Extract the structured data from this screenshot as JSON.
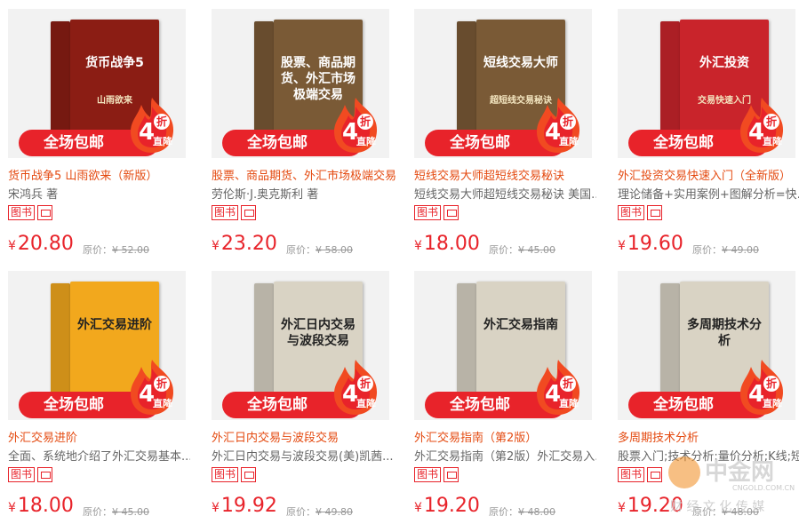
{
  "products": [
    {
      "name": "货币战争5 山雨欲来（新版）",
      "subtitle": "宋鸿兵 著",
      "cover_title": "货币战争5",
      "cover_sub": "山雨欲来",
      "cover_color": "#8b1d14",
      "price": "20.80",
      "orig_label": "原价：",
      "orig_price": "¥ 52.00"
    },
    {
      "name": "股票、商品期货、外汇市场极端交易",
      "subtitle": "劳伦斯·J.奥克斯利 著",
      "cover_title": "股票、商品期货、外汇市场极端交易",
      "cover_sub": "",
      "cover_color": "#7a5a36",
      "price": "23.20",
      "orig_label": "原价：",
      "orig_price": "¥ 58.00"
    },
    {
      "name": "短线交易大师超短线交易秘诀",
      "subtitle": "短线交易大师超短线交易秘诀 美国...",
      "cover_title": "短线交易大师",
      "cover_sub": "超短线交易秘诀",
      "cover_color": "#7a5a36",
      "price": "18.00",
      "orig_label": "原价：",
      "orig_price": "¥ 45.00"
    },
    {
      "name": "外汇投资交易快速入门（全新版）",
      "subtitle": "理论储备+实用案例+图解分析=快...",
      "cover_title": "外汇投资",
      "cover_sub": "交易快速入门",
      "cover_color": "#c9242b",
      "price": "19.60",
      "orig_label": "原价：",
      "orig_price": "¥ 49.00"
    },
    {
      "name": "外汇交易进阶",
      "subtitle": "全面、系统地介绍了外汇交易基本...",
      "cover_title": "外汇交易进阶",
      "cover_sub": "",
      "cover_color": "#f2a81d",
      "price": "18.00",
      "orig_label": "原价：",
      "orig_price": "¥ 45.00"
    },
    {
      "name": "外汇日内交易与波段交易",
      "subtitle": "外汇日内交易与波段交易(美)凯茜...",
      "cover_title": "外汇日内交易与波段交易",
      "cover_sub": "",
      "cover_color": "#d9d3c4",
      "price": "19.92",
      "orig_label": "原价：",
      "orig_price": "¥ 49.80"
    },
    {
      "name": "外汇交易指南（第2版）",
      "subtitle": "外汇交易指南（第2版）外汇交易入...",
      "cover_title": "外汇交易指南",
      "cover_sub": "",
      "cover_color": "#d9d3c4",
      "price": "19.20",
      "orig_label": "原价：",
      "orig_price": "¥ 48.00"
    },
    {
      "name": "多周期技术分析",
      "subtitle": "股票入门;技术分析;量价分析;K线;短...",
      "cover_title": "多周期技术分析",
      "cover_sub": "",
      "cover_color": "#d9d3c4",
      "price": "19.20",
      "orig_label": "原价：",
      "orig_price": "¥ 48.00"
    }
  ],
  "promo_label": "全场包邮",
  "discount_num": "4",
  "discount_zhe": "折",
  "discount_tag": "直降",
  "tag_label": "图书",
  "currency": "¥",
  "watermark": {
    "name": "中金网",
    "domain": "CNGOLD.COM.CN",
    "slogan": "财 经 文 化 传 媒"
  },
  "colors": {
    "accent": "#e8232a",
    "title": "#e44a10",
    "muted": "#999999"
  }
}
